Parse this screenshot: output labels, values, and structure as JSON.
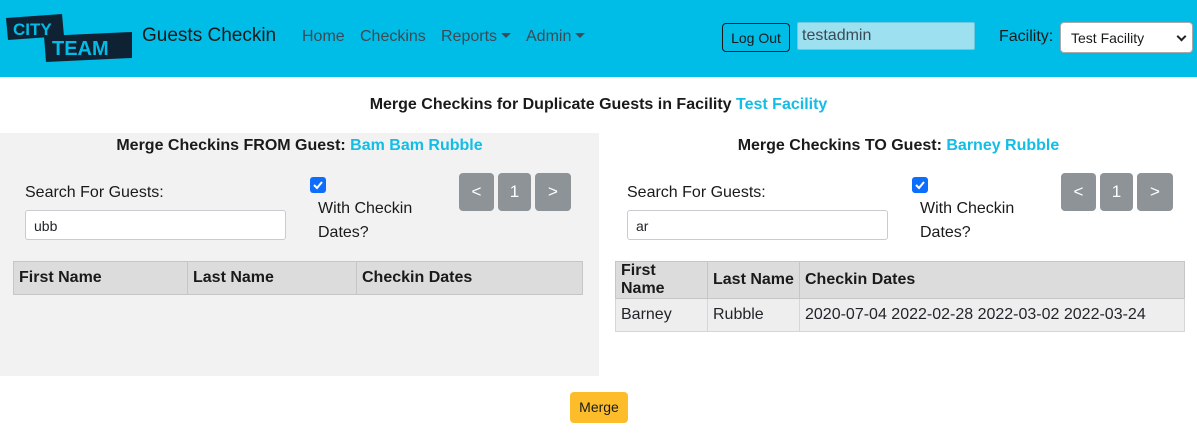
{
  "header": {
    "logo": "CITY TEAM",
    "brand": "Guests Checkin",
    "nav": [
      {
        "label": "Home"
      },
      {
        "label": "Checkins"
      },
      {
        "label": "Reports",
        "dropdown": true
      },
      {
        "label": "Admin",
        "dropdown": true
      }
    ],
    "logout_label": "Log Out",
    "username": "testadmin",
    "facility_label": "Facility:",
    "facility_selected": "Test Facility"
  },
  "page": {
    "heading_prefix": "Merge Checkins for Duplicate Guests in Facility",
    "facility_name": "Test Facility"
  },
  "from_panel": {
    "title_prefix": "Merge Checkins FROM Guest:",
    "guest_name": "Bam Bam Rubble",
    "search_label": "Search For Guests:",
    "search_value": "ubb",
    "checkbox_checked": true,
    "checkbox_label": "With Checkin Dates?",
    "pager": {
      "prev": "<",
      "page": "1",
      "next": ">"
    },
    "columns": [
      "First Name",
      "Last Name",
      "Checkin Dates"
    ],
    "rows": []
  },
  "to_panel": {
    "title_prefix": "Merge Checkins TO Guest:",
    "guest_name": "Barney Rubble",
    "search_label": "Search For Guests:",
    "search_value": "ar",
    "checkbox_checked": true,
    "checkbox_label": "With Checkin Dates?",
    "pager": {
      "prev": "<",
      "page": "1",
      "next": ">"
    },
    "columns": [
      "First Name",
      "Last Name",
      "Checkin Dates"
    ],
    "rows": [
      {
        "first": "Barney",
        "last": "Rubble",
        "dates": "2020-07-04 2022-02-28 2022-03-02 2022-03-24"
      }
    ]
  },
  "merge_label": "Merge",
  "colors": {
    "navbar": "#00bde8",
    "accent": "#12bde6",
    "merge": "#fdbd2b",
    "pager": "#8e9397"
  }
}
